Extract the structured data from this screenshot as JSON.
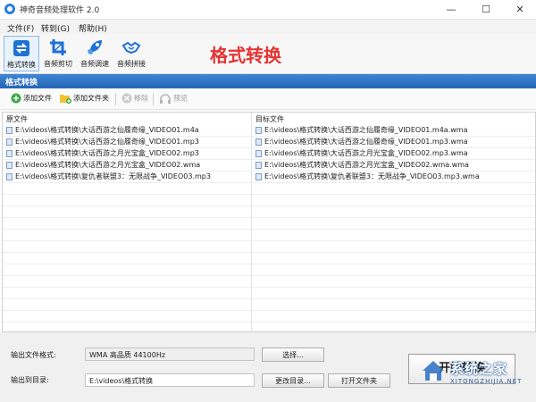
{
  "window": {
    "title": "神奇音频处理软件 2.0",
    "minimize": "—",
    "maximize": "☐",
    "close": "✕"
  },
  "menu": {
    "items": [
      "文件(F)",
      "转到(G)",
      "帮助(H)"
    ]
  },
  "toolbar": {
    "tools": [
      {
        "label": "格式转换",
        "icon": "format-convert-icon",
        "active": true
      },
      {
        "label": "音频剪切",
        "icon": "crop-icon",
        "active": false
      },
      {
        "label": "音频调速",
        "icon": "rocket-icon",
        "active": false
      },
      {
        "label": "音频拼接",
        "icon": "handshake-icon",
        "active": false
      }
    ],
    "page_heading": "格式转换"
  },
  "section": {
    "title": "格式转换"
  },
  "actions": {
    "add_file": "添加文件",
    "add_folder": "添加文件夹",
    "remove": "移除",
    "preview": "预览"
  },
  "file_list": {
    "source_header": "原文件",
    "target_header": "目标文件",
    "source_files": [
      "E:\\videos\\格式转换\\大话西游之仙履奇缘_VIDEO01.m4a",
      "E:\\videos\\格式转换\\大话西游之仙履奇缘_VIDEO01.mp3",
      "E:\\videos\\格式转换\\大话西游之月光宝盒_VIDEO02.mp3",
      "E:\\videos\\格式转换\\大话西游之月光宝盒_VIDEO02.wma",
      "E:\\videos\\格式转换\\复仇者联盟3：无限战争_VIDEO03.mp3"
    ],
    "target_files": [
      "E:\\videos\\格式转换\\大话西游之仙履奇缘_VIDEO01.m4a.wma",
      "E:\\videos\\格式转换\\大话西游之仙履奇缘_VIDEO01.mp3.wma",
      "E:\\videos\\格式转换\\大话西游之月光宝盒_VIDEO02.mp3.wma",
      "E:\\videos\\格式转换\\大话西游之月光宝盒_VIDEO02.wma.wma",
      "E:\\videos\\格式转换\\复仇者联盟3：无限战争_VIDEO03.mp3.wma"
    ]
  },
  "output": {
    "format_label": "输出文件格式:",
    "format_value": "WMA 高品质 44100Hz",
    "choose_button": "选择...",
    "dir_label": "输出到目录:",
    "dir_value": "E:\\videos\\格式转换",
    "change_dir_button": "更改目录...",
    "open_folder_button": "打开文件夹",
    "start_button": "开始转换"
  },
  "watermark": {
    "text": "系统之家",
    "sub": "XITONGZHIJIA.NET"
  }
}
